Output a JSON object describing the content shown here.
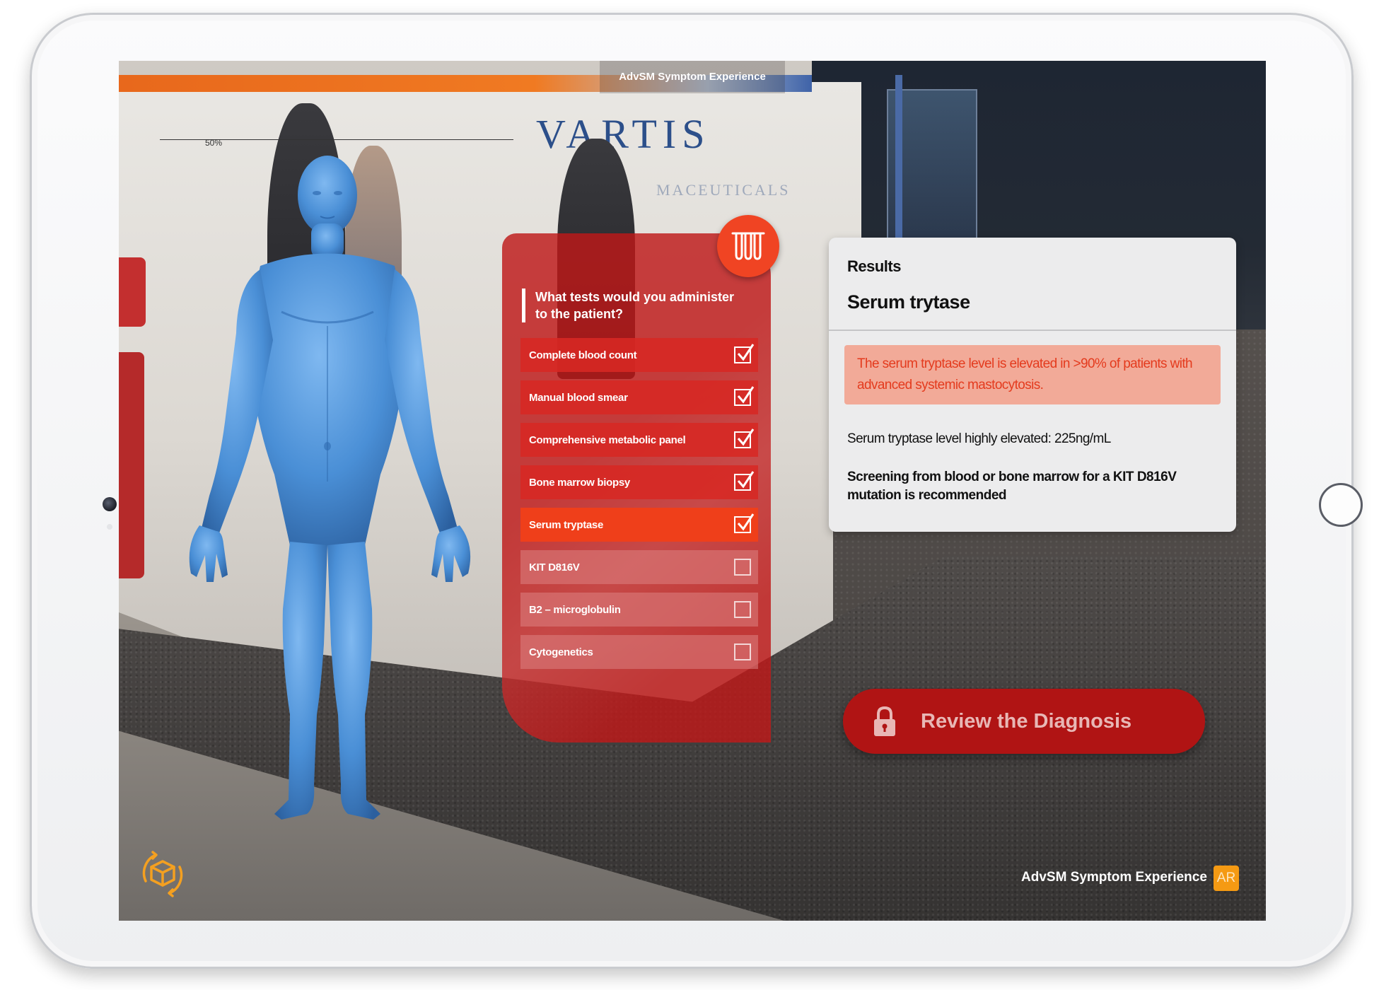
{
  "app": {
    "title": "AdvSM Symptom Experience",
    "footer_title": "AdvSM Symptom Experience",
    "ar_badge": "AR",
    "scale_label": "50%",
    "background_logo": "VARTIS",
    "background_logo_sub": "MACEUTICALS"
  },
  "tests_panel": {
    "icon": "test-tubes-icon",
    "question": "What tests would you administer to the  patient?",
    "items": [
      {
        "label": "Complete blood count",
        "state": "checked"
      },
      {
        "label": "Manual blood smear",
        "state": "checked"
      },
      {
        "label": "Comprehensive metabolic panel",
        "state": "checked"
      },
      {
        "label": "Bone marrow biopsy",
        "state": "checked"
      },
      {
        "label": "Serum tryptase",
        "state": "active"
      },
      {
        "label": "KIT D816V",
        "state": "unchecked"
      },
      {
        "label": "B2 – microglobulin",
        "state": "unchecked"
      },
      {
        "label": "Cytogenetics",
        "state": "unchecked"
      }
    ]
  },
  "results": {
    "label": "Results",
    "title": "Serum trytase",
    "alert": "The serum tryptase level is elevated in >90% of patients with advanced systemic mastocytosis.",
    "value": "Serum tryptase level highly elevated: 225ng/mL",
    "recommendation": "Screening from blood or bone marrow for a KIT D816V mutation is recommended"
  },
  "review_button": {
    "label": "Review the Diagnosis",
    "icon": "lock-icon",
    "locked": true
  },
  "colors": {
    "accent_red": "#b01414",
    "accent_orange": "#ef3f1a",
    "figure_blue": "#4a8fd6",
    "ar_orange": "#f59a13"
  }
}
